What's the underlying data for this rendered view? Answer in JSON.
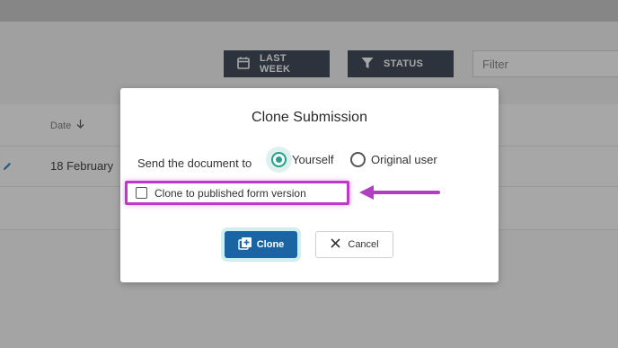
{
  "toolbar": {
    "last_week_label": "LAST WEEK",
    "status_label": "STATUS",
    "filter_placeholder": "Filter"
  },
  "table": {
    "date_header": "Date",
    "rows": [
      {
        "date": "18 February"
      }
    ]
  },
  "modal": {
    "title": "Clone Submission",
    "send_label": "Send the document to",
    "options": [
      {
        "label": "Yourself",
        "checked": true
      },
      {
        "label": "Original user",
        "checked": false
      }
    ],
    "clone_checkbox_label": "Clone to published form version",
    "clone_checkbox_checked": false,
    "clone_button_label": "Clone",
    "cancel_button_label": "Cancel"
  },
  "colors": {
    "toolbar_button": "#1f2d3d",
    "accent_teal": "#20a38a",
    "primary_button": "#1a64a3",
    "highlight_magenta": "#c038c8"
  }
}
